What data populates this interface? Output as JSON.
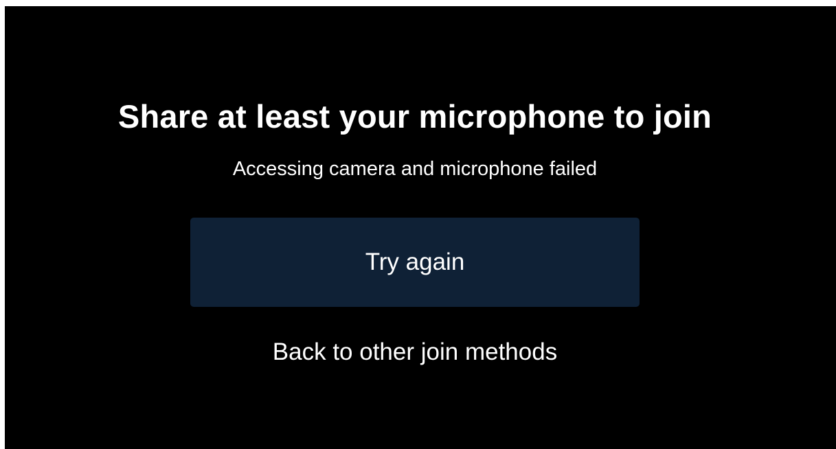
{
  "dialog": {
    "title": "Share at least your microphone to join",
    "message": "Accessing camera and microphone failed",
    "try_again_label": "Try again",
    "back_label": "Back to other join methods"
  },
  "colors": {
    "background": "#000000",
    "button_background": "#0f2136",
    "text": "#ffffff"
  }
}
